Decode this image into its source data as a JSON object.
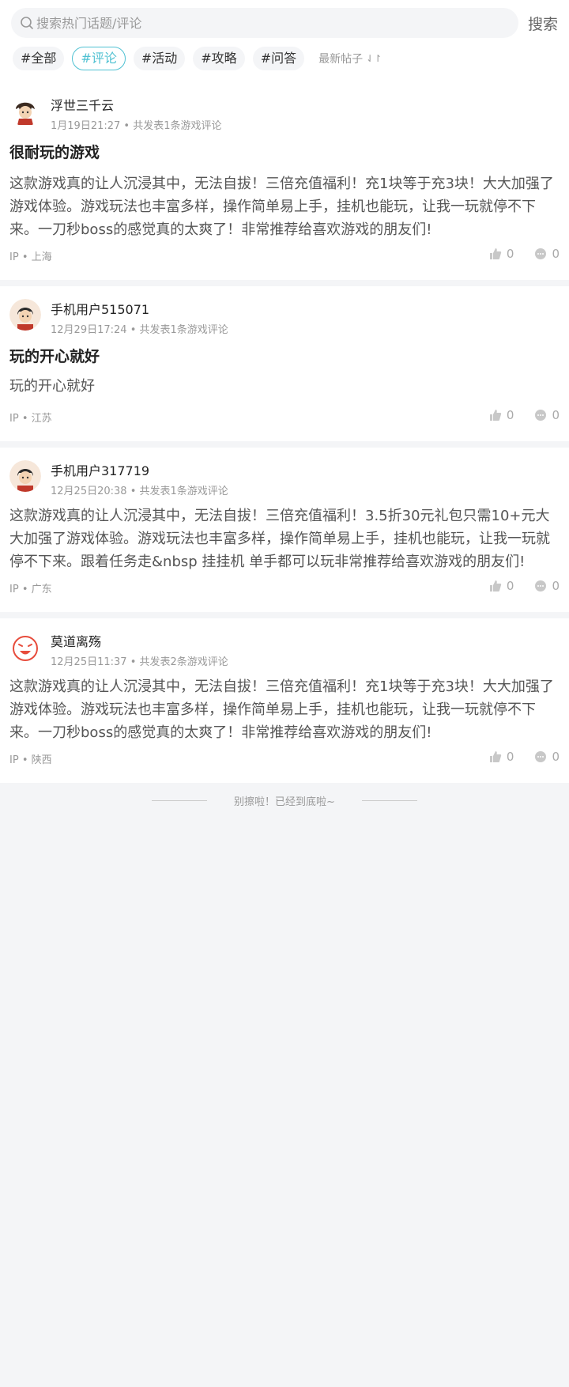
{
  "search": {
    "placeholder": "搜索热门话题/评论",
    "button": "搜索"
  },
  "tags": [
    "#全部",
    "#评论",
    "#活动",
    "#攻略",
    "#问答"
  ],
  "sort_label": "最新帖子",
  "sort_icon": "sort-arrows-icon",
  "posts": [
    {
      "user": "浮世三千云",
      "time": "1月19日21:27",
      "count": "共发表1条游戏评论",
      "title": "很耐玩的游戏",
      "body": "这款游戏真的让人沉浸其中，无法自拔！三倍充值福利！充1块等于充3块！大大加强了游戏体验。游戏玩法也丰富多样，操作简单易上手，挂机也能玩，让我一玩就停不下来。一刀秒boss的感觉真的太爽了！非常推荐给喜欢游戏的朋友们!",
      "ip_label": "IP",
      "region": "上海",
      "likes": "0",
      "comments": "0"
    },
    {
      "user": "手机用户515071",
      "time": "12月29日17:24",
      "count": "共发表1条游戏评论",
      "title": "玩的开心就好",
      "body": "玩的开心就好",
      "ip_label": "IP",
      "region": "江苏",
      "likes": "0",
      "comments": "0"
    },
    {
      "user": "手机用户317719",
      "time": "12月25日20:38",
      "count": "共发表1条游戏评论",
      "title": "",
      "body": "这款游戏真的让人沉浸其中，无法自拔！三倍充值福利！3.5折30元礼包只需10+元大大加强了游戏体验。游戏玩法也丰富多样，操作简单易上手，挂机也能玩，让我一玩就停不下来。跟着任务走&nbsp 挂挂机 单手都可以玩非常推荐给喜欢游戏的朋友们!",
      "ip_label": "IP",
      "region": "广东",
      "likes": "0",
      "comments": "0"
    },
    {
      "user": "莫道离殇",
      "time": "12月25日11:37",
      "count": "共发表2条游戏评论",
      "title": "",
      "body": "这款游戏真的让人沉浸其中，无法自拔！三倍充值福利！充1块等于充3块！大大加强了游戏体验。游戏玩法也丰富多样，操作简单易上手，挂机也能玩，让我一玩就停不下来。一刀秒boss的感觉真的太爽了！非常推荐给喜欢游戏的朋友们!",
      "ip_label": "IP",
      "region": "陕西",
      "likes": "0",
      "comments": "0"
    }
  ],
  "end_text": "别擦啦！已经到底啦~",
  "colors": {
    "accent": "#4fc1d2",
    "background": "#f4f5f7"
  }
}
